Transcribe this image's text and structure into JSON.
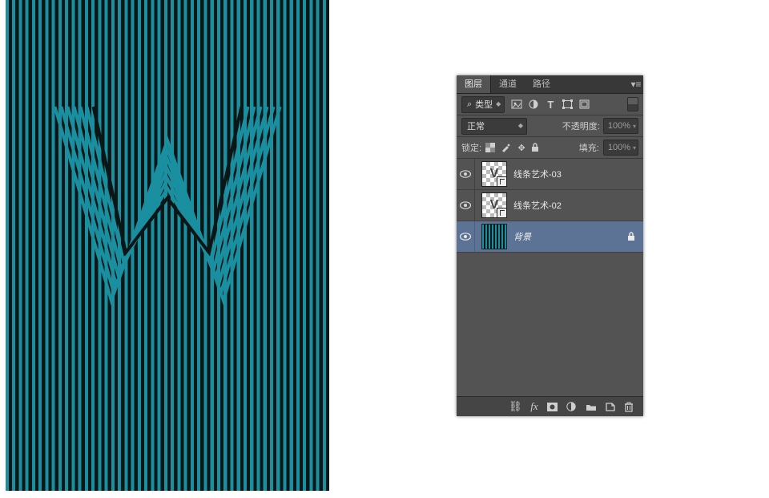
{
  "panel": {
    "tabs": {
      "layers": "图层",
      "channels": "通道",
      "paths": "路径"
    },
    "filter": {
      "kind_label": "类型",
      "search_glyph": "⌕"
    },
    "blend": {
      "mode": "正常",
      "opacity_label": "不透明度:",
      "opacity_value": "100%"
    },
    "lock": {
      "label": "锁定:",
      "fill_label": "填充:",
      "fill_value": "100%"
    },
    "layers": [
      {
        "name": "线条艺术-03"
      },
      {
        "name": "线条艺术-02"
      },
      {
        "name": "背景"
      }
    ]
  },
  "canvas": {
    "stripe_color": "#198fa0",
    "bg_color": "#0b1617",
    "letter": "W"
  }
}
